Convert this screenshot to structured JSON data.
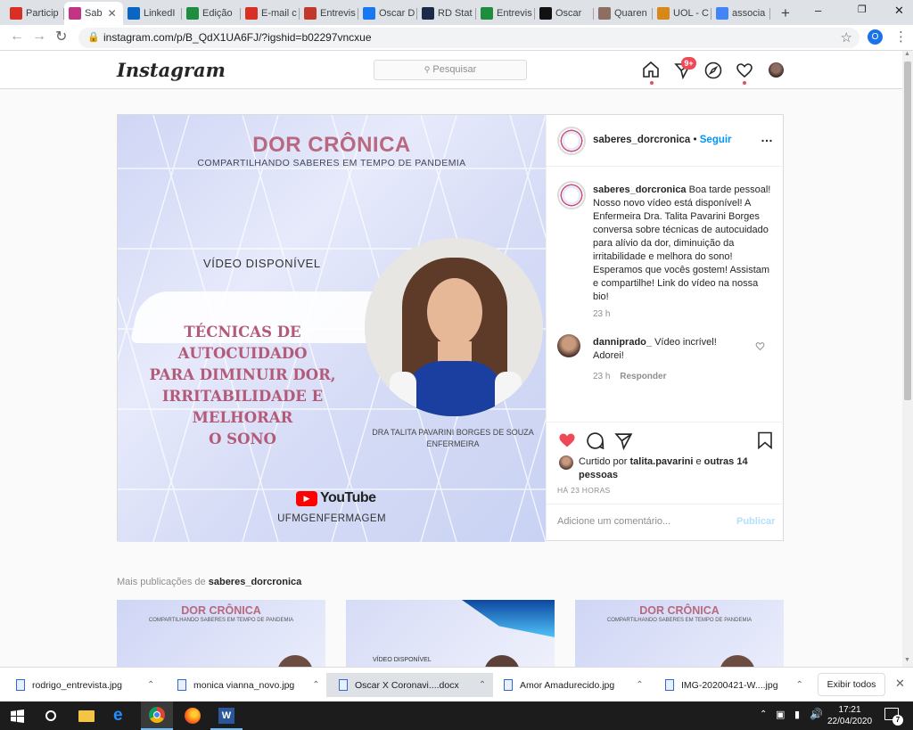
{
  "browser": {
    "tabs": [
      {
        "label": "Particip",
        "icon": "gmail-icon",
        "color": "#d93025"
      },
      {
        "label": "Sab",
        "icon": "instagram-icon",
        "color": "#c13584",
        "active": true
      },
      {
        "label": "LinkedI",
        "icon": "linkedin-icon",
        "color": "#0a66c2"
      },
      {
        "label": "Edição",
        "icon": "circle-check-icon",
        "color": "#1e8e3e"
      },
      {
        "label": "E-mail c",
        "icon": "gmail-icon",
        "color": "#d93025"
      },
      {
        "label": "Entrevis",
        "icon": "plane-icon",
        "color": "#c0392b"
      },
      {
        "label": "Oscar D",
        "icon": "facebook-icon",
        "color": "#1877f2"
      },
      {
        "label": "RD Stat",
        "icon": "rd-icon",
        "color": "#1b2a4a"
      },
      {
        "label": "Entrevis",
        "icon": "circle-check-icon",
        "color": "#1e8e3e"
      },
      {
        "label": "Oscar",
        "icon": "od-icon",
        "color": "#111111"
      },
      {
        "label": "Quaren",
        "icon": "recipe-icon",
        "color": "#8d6e63"
      },
      {
        "label": "UOL - C",
        "icon": "uol-icon",
        "color": "#d6881b"
      },
      {
        "label": "associa",
        "icon": "google-icon",
        "color": "#4285f4"
      }
    ],
    "new_tab": "+",
    "url": "instagram.com/p/B_QdX1UA6FJ/?igshid=b02297vncxue",
    "profile_initial": "O"
  },
  "instagram": {
    "logo": "Instagram",
    "search_placeholder": "Pesquisar",
    "notif_badge": "9+"
  },
  "image": {
    "title": "DOR CRÔNICA",
    "subtitle": "COMPARTILHANDO SABERES EM TEMPO DE PANDEMIA",
    "available": "VÍDEO DISPONÍVEL",
    "headline": [
      "TÉCNICAS DE AUTOCUIDADO",
      "PARA DIMINUIR DOR,",
      "IRRITABILIDADE E MELHORAR",
      "O SONO"
    ],
    "speaker": "DRA TALITA PAVARINI BORGES DE SOUZA",
    "role": "ENFERMEIRA",
    "youtube": "YouTube",
    "channel": "UFMGENFERMAGEM"
  },
  "post": {
    "username": "saberes_dorcronica",
    "follow": "Seguir",
    "dot": "•",
    "caption": "Boa tarde pessoal! Nosso novo vídeo está disponível! A Enfermeira Dra. Talita Pavarini Borges conversa sobre técnicas de autocuidado para alívio da dor, diminuição da irritabilidade e melhora do sono! Esperamos que vocês gostem! Assistam e compartilhe! Link do vídeo na nossa bio!",
    "caption_time": "23 h",
    "comment_user": "danniprado_",
    "comment_text": "Vídeo incrível! Adorei!",
    "comment_time": "23 h",
    "reply": "Responder",
    "liked_prefix": "Curtido por",
    "liked_user": "talita.pavarini",
    "liked_and": "e",
    "liked_others": "outras 14 pessoas",
    "timestamp": "HÁ 23 HORAS",
    "comment_placeholder": "Adicione um comentário...",
    "publish": "Publicar"
  },
  "more": {
    "label": "Mais publicações de",
    "user": "saberes_dorcronica",
    "thumbs": [
      {
        "title": "DOR CRÔNICA",
        "subtitle": "COMPARTILHANDO SABERES EM TEMPO DE PANDEMIA"
      },
      {
        "title": "",
        "subtitle": "VÍDEO DISPONÍVEL"
      },
      {
        "title": "DOR CRÔNICA",
        "subtitle": "COMPARTILHANDO SABERES EM TEMPO DE PANDEMIA"
      }
    ]
  },
  "downloads": {
    "items": [
      "rodrigo_entrevista.jpg",
      "monica vianna_novo.jpg",
      "Oscar X Coronavi....docx",
      "Amor Amadurecido.jpg",
      "IMG-20200421-W....jpg"
    ],
    "show_all": "Exibir todos"
  },
  "taskbar": {
    "time": "17:21",
    "date": "22/04/2020",
    "notif_count": "7"
  },
  "colors": {
    "accent": "#0095f6",
    "like": "#ed4956",
    "headline": "#b35a78",
    "title": "#b8687f"
  }
}
